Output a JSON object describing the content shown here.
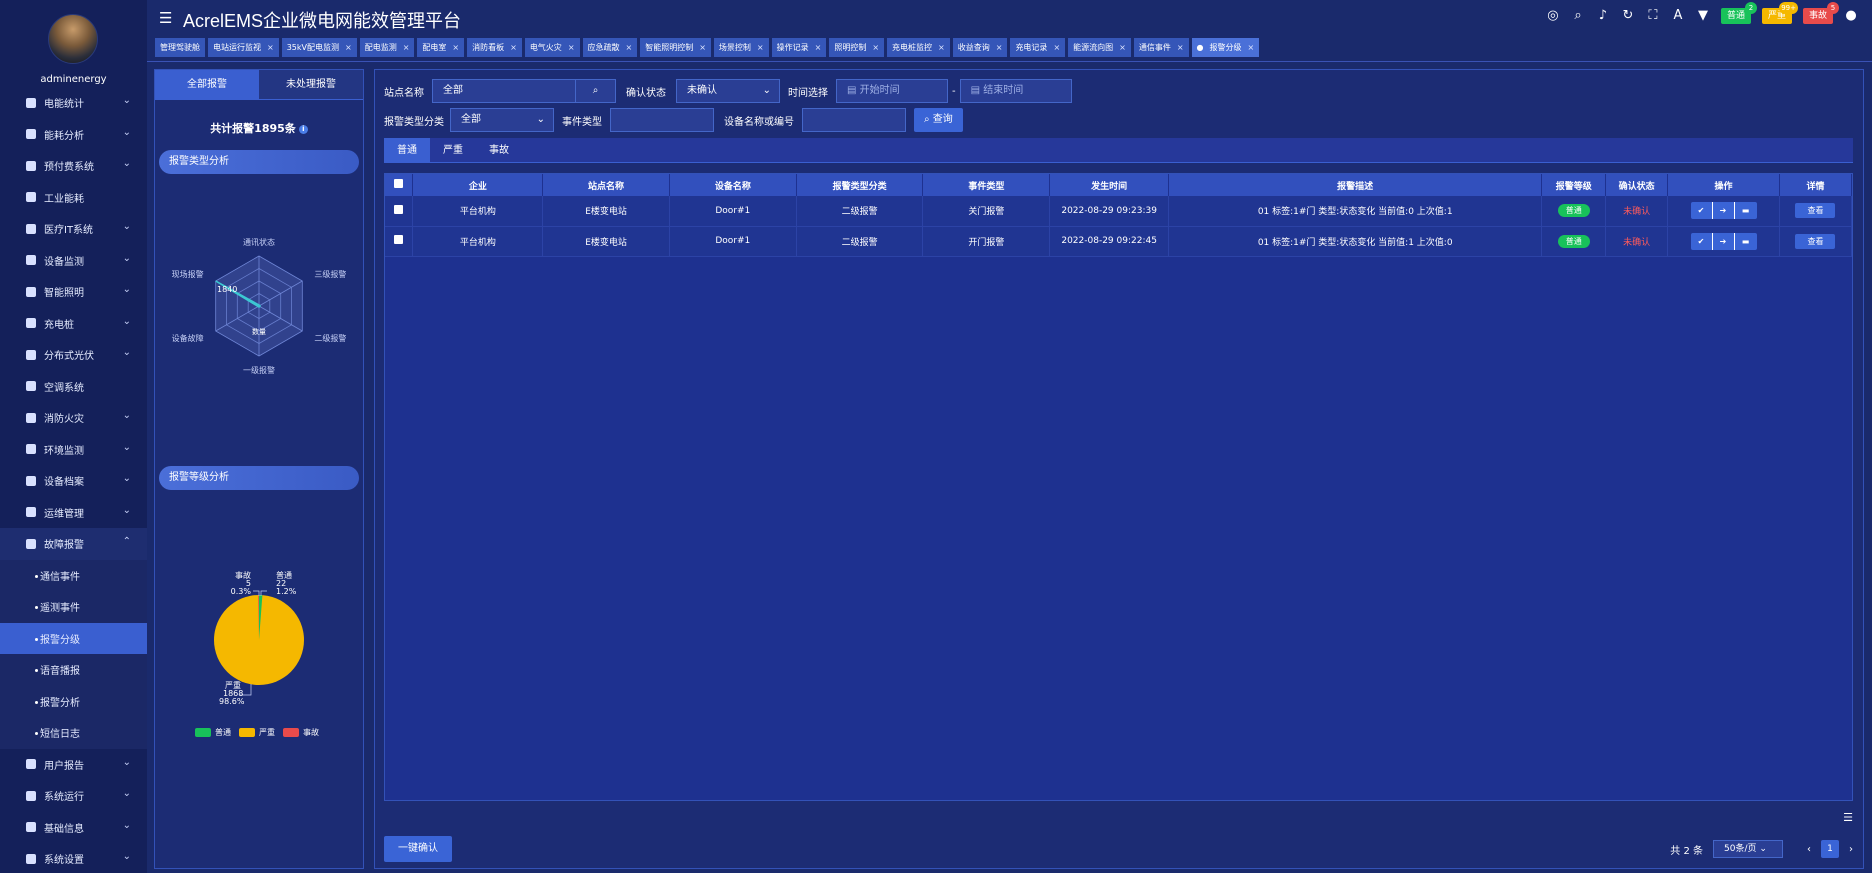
{
  "header": {
    "title": "AcrelEMS企业微电网能效管理平台"
  },
  "badges": [
    {
      "label": "普通",
      "count": "2",
      "color": "#18c25a",
      "countColor": "#18c25a"
    },
    {
      "label": "严重",
      "count": "99+",
      "color": "#f5b800",
      "countColor": "#f5b800"
    },
    {
      "label": "事故",
      "count": "5",
      "color": "#e84b4b",
      "countColor": "#e84b4b"
    }
  ],
  "user": {
    "name": "adminenergy"
  },
  "menu": [
    "电能统计",
    "能耗分析",
    "预付费系统",
    "工业能耗",
    "医疗IT系统",
    "设备监测",
    "智能照明",
    "充电桩",
    "分布式光伏",
    "空调系统",
    "消防火灾",
    "环境监测",
    "设备档案",
    "运维管理",
    "故障报警"
  ],
  "submenu": [
    "通信事件",
    "遥测事件",
    "报警分级",
    "语音播报",
    "报警分析",
    "短信日志"
  ],
  "menu_after": [
    "用户报告",
    "系统运行",
    "基础信息",
    "系统设置"
  ],
  "tabs": [
    "管理驾驶舱",
    "电站运行监视",
    "35kV配电监测",
    "配电监测",
    "配电室",
    "消防看板",
    "电气火灾",
    "应急疏散",
    "智能照明控制",
    "场景控制",
    "操作记录",
    "照明控制",
    "充电桩监控",
    "收益查询",
    "充电记录",
    "能源流向图",
    "通信事件",
    "报警分级"
  ],
  "left": {
    "tab_all": "全部报警",
    "tab_unhandled": "未处理报警",
    "total": "共计报警1895条",
    "radar_title": "报警类型分析",
    "level_title": "报警等级分析",
    "radar": {
      "labels": [
        "通讯状态",
        "三级报警",
        "二级报警",
        "一级报警",
        "设备故障",
        "现场报警"
      ],
      "value_label": "1840",
      "center_label": "数量"
    },
    "pie": {
      "labels": [
        "事故",
        "5",
        "0.3%",
        "普通",
        "22",
        "1.2%",
        "严重",
        "1868",
        "98.6%"
      ]
    },
    "legend": [
      "普通",
      "严重",
      "事故"
    ]
  },
  "filters": {
    "site_label": "站点名称",
    "site_value": "全部",
    "confirm_label": "确认状态",
    "confirm_value": "未确认",
    "time_label": "时间选择",
    "start_ph": "开始时间",
    "dash": "-",
    "end_ph": "结束时间",
    "type_label": "报警类型分类",
    "type_value": "全部",
    "event_label": "事件类型",
    "event_value": "",
    "device_label": "设备名称或编号",
    "device_value": "",
    "query_btn": "查询"
  },
  "subtabs": [
    "普通",
    "严重",
    "事故"
  ],
  "table": {
    "headers": [
      "企业",
      "站点名称",
      "设备名称",
      "报警类型分类",
      "事件类型",
      "发生时间",
      "报警描述",
      "报警等级",
      "确认状态",
      "操作",
      "详情"
    ],
    "rows": [
      [
        "平台机构",
        "E楼变电站",
        "Door#1",
        "二级报警",
        "关门报警",
        "2022-08-29 09:23:39",
        "01 标签:1#门 类型:状态变化 当前值:0 上次值:1",
        "普通",
        "未确认",
        "查看"
      ],
      [
        "平台机构",
        "E楼变电站",
        "Door#1",
        "二级报警",
        "开门报警",
        "2022-08-29 09:22:45",
        "01 标签:1#门 类型:状态变化 当前值:1 上次值:0",
        "普通",
        "未确认",
        "查看"
      ]
    ]
  },
  "bottom": {
    "confirm_all": "一键确认",
    "total": "共 2 条",
    "page_size": "50条/页",
    "page": "1"
  }
}
